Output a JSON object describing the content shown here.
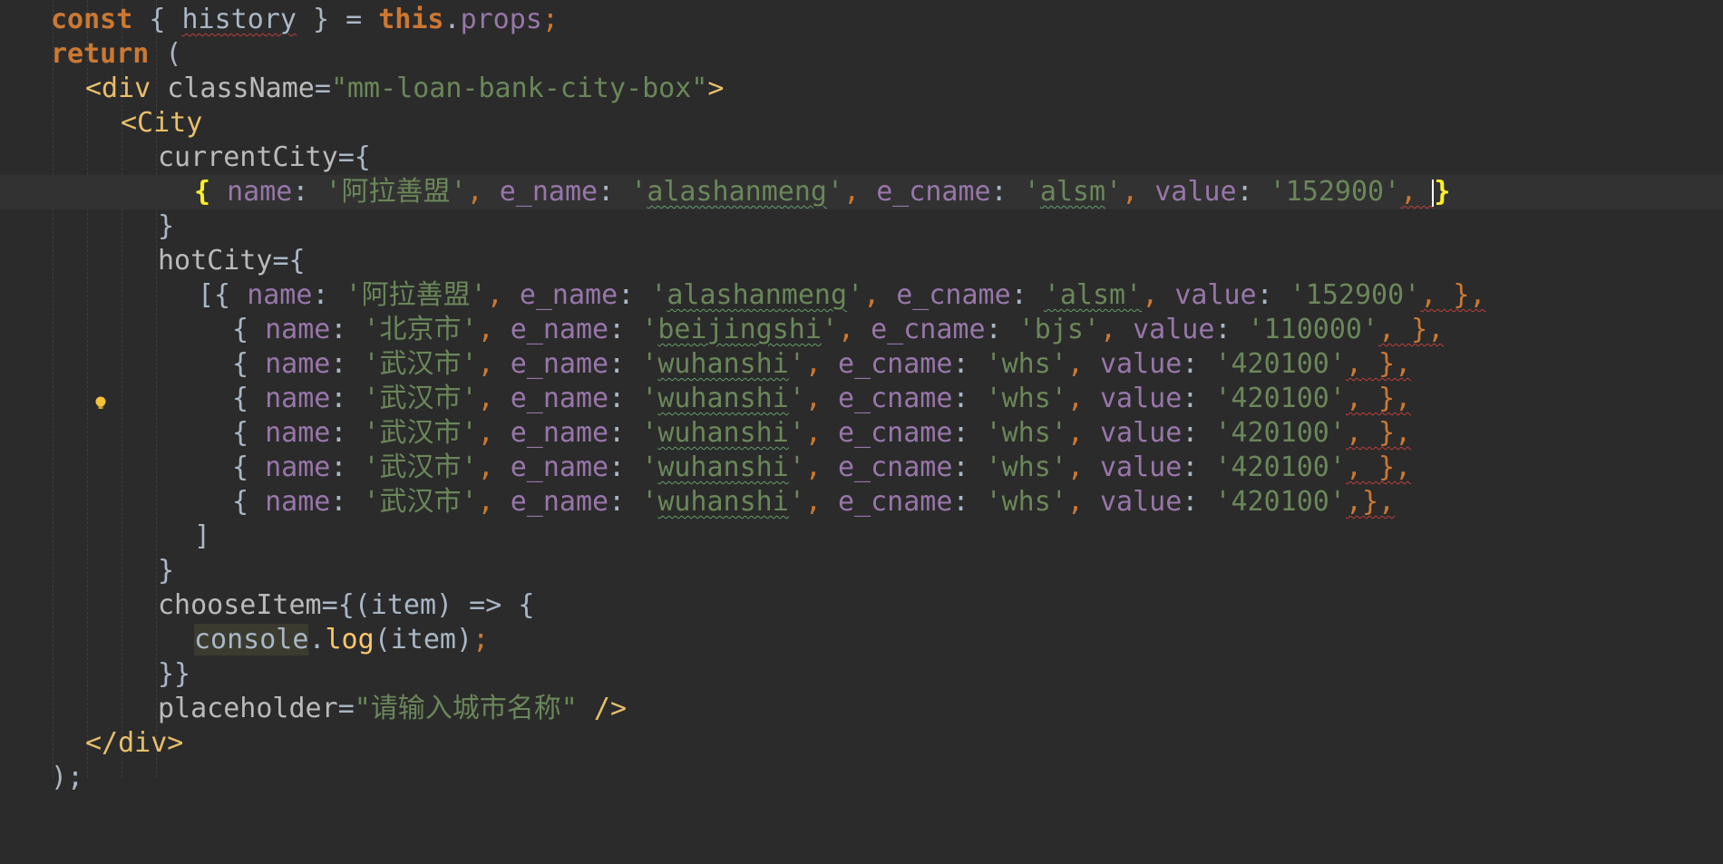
{
  "editor": {
    "line1": {
      "kw1": "const",
      "p1": " { ",
      "var": "history",
      "p2": " } = ",
      "kw2": "this",
      "p3": ".",
      "prop": "props",
      "semi": ";"
    },
    "line2": {
      "kw": "return",
      "p": " ("
    },
    "line3": {
      "open": "<div",
      "attr": " className",
      "eq": "=",
      "val": "\"mm-loan-bank-city-box\"",
      "close": ">"
    },
    "line4": {
      "open": "<City"
    },
    "line5": {
      "attr": "currentCity",
      "eq": "=",
      "brace": "{"
    },
    "line6": {
      "ob": "{",
      "k1": " name",
      "c1": ": ",
      "v1": "'阿拉善盟'",
      "s1": ", ",
      "k2": "e_name",
      "c2": ": ",
      "v2q1": "'",
      "v2": "alashanmeng",
      "v2q2": "'",
      "s2": ", ",
      "k3": "e_cname",
      "c3": ": ",
      "v3q1": "'",
      "v3": "alsm",
      "v3q2": "'",
      "s3": ", ",
      "k4": "value",
      "c4": ": ",
      "v4": "'152900'",
      "s4": ", ",
      "cb": "}"
    },
    "line7": {
      "brace": "}"
    },
    "line8": {
      "attr": "hotCity",
      "eq": "=",
      "brace": "{"
    },
    "hot_cities": [
      {
        "lead": "[{",
        "name": "'阿拉善盟'",
        "e_name": "alashanmeng",
        "e_cname": "alsm",
        "value": "'152900'",
        "tail": ", },"
      },
      {
        "lead": "{",
        "name": "'北京市'",
        "e_name": "beijingshi",
        "e_cname": "'bjs'",
        "value": "'110000'",
        "tail": ", },"
      },
      {
        "lead": "{",
        "name": "'武汉市'",
        "e_name": "wuhanshi",
        "e_cname": "'whs'",
        "value": "'420100'",
        "tail": ", },"
      },
      {
        "lead": "{",
        "name": "'武汉市'",
        "e_name": "wuhanshi",
        "e_cname": "'whs'",
        "value": "'420100'",
        "tail": ", },"
      },
      {
        "lead": "{",
        "name": "'武汉市'",
        "e_name": "wuhanshi",
        "e_cname": "'whs'",
        "value": "'420100'",
        "tail": ", },"
      },
      {
        "lead": "{",
        "name": "'武汉市'",
        "e_name": "wuhanshi",
        "e_cname": "'whs'",
        "value": "'420100'",
        "tail": ", },"
      },
      {
        "lead": "{",
        "name": "'武汉市'",
        "e_name": "wuhanshi",
        "e_cname": "'whs'",
        "value": "'420100'",
        "tail": ",},"
      }
    ],
    "keys": {
      "name": "name",
      "e_name": "e_name",
      "e_cname": "e_cname",
      "value": "value",
      "colon": ": ",
      "sep": ", "
    },
    "line16": {
      "bracket": "]"
    },
    "line17": {
      "brace": "}"
    },
    "line18": {
      "attr": "chooseItem",
      "eq": "=",
      "rest": "{(item) => {"
    },
    "line19": {
      "obj": "console",
      "dot": ".",
      "fn": "log",
      "args": "(item)",
      "semi": ";"
    },
    "line20": {
      "brace": "}}"
    },
    "line21": {
      "attr": "placeholder",
      "eq": "=",
      "val": "\"请输入城市名称\"",
      "close": " />"
    },
    "line22": {
      "close": "</div>"
    },
    "line23": {
      "text": ");"
    }
  }
}
